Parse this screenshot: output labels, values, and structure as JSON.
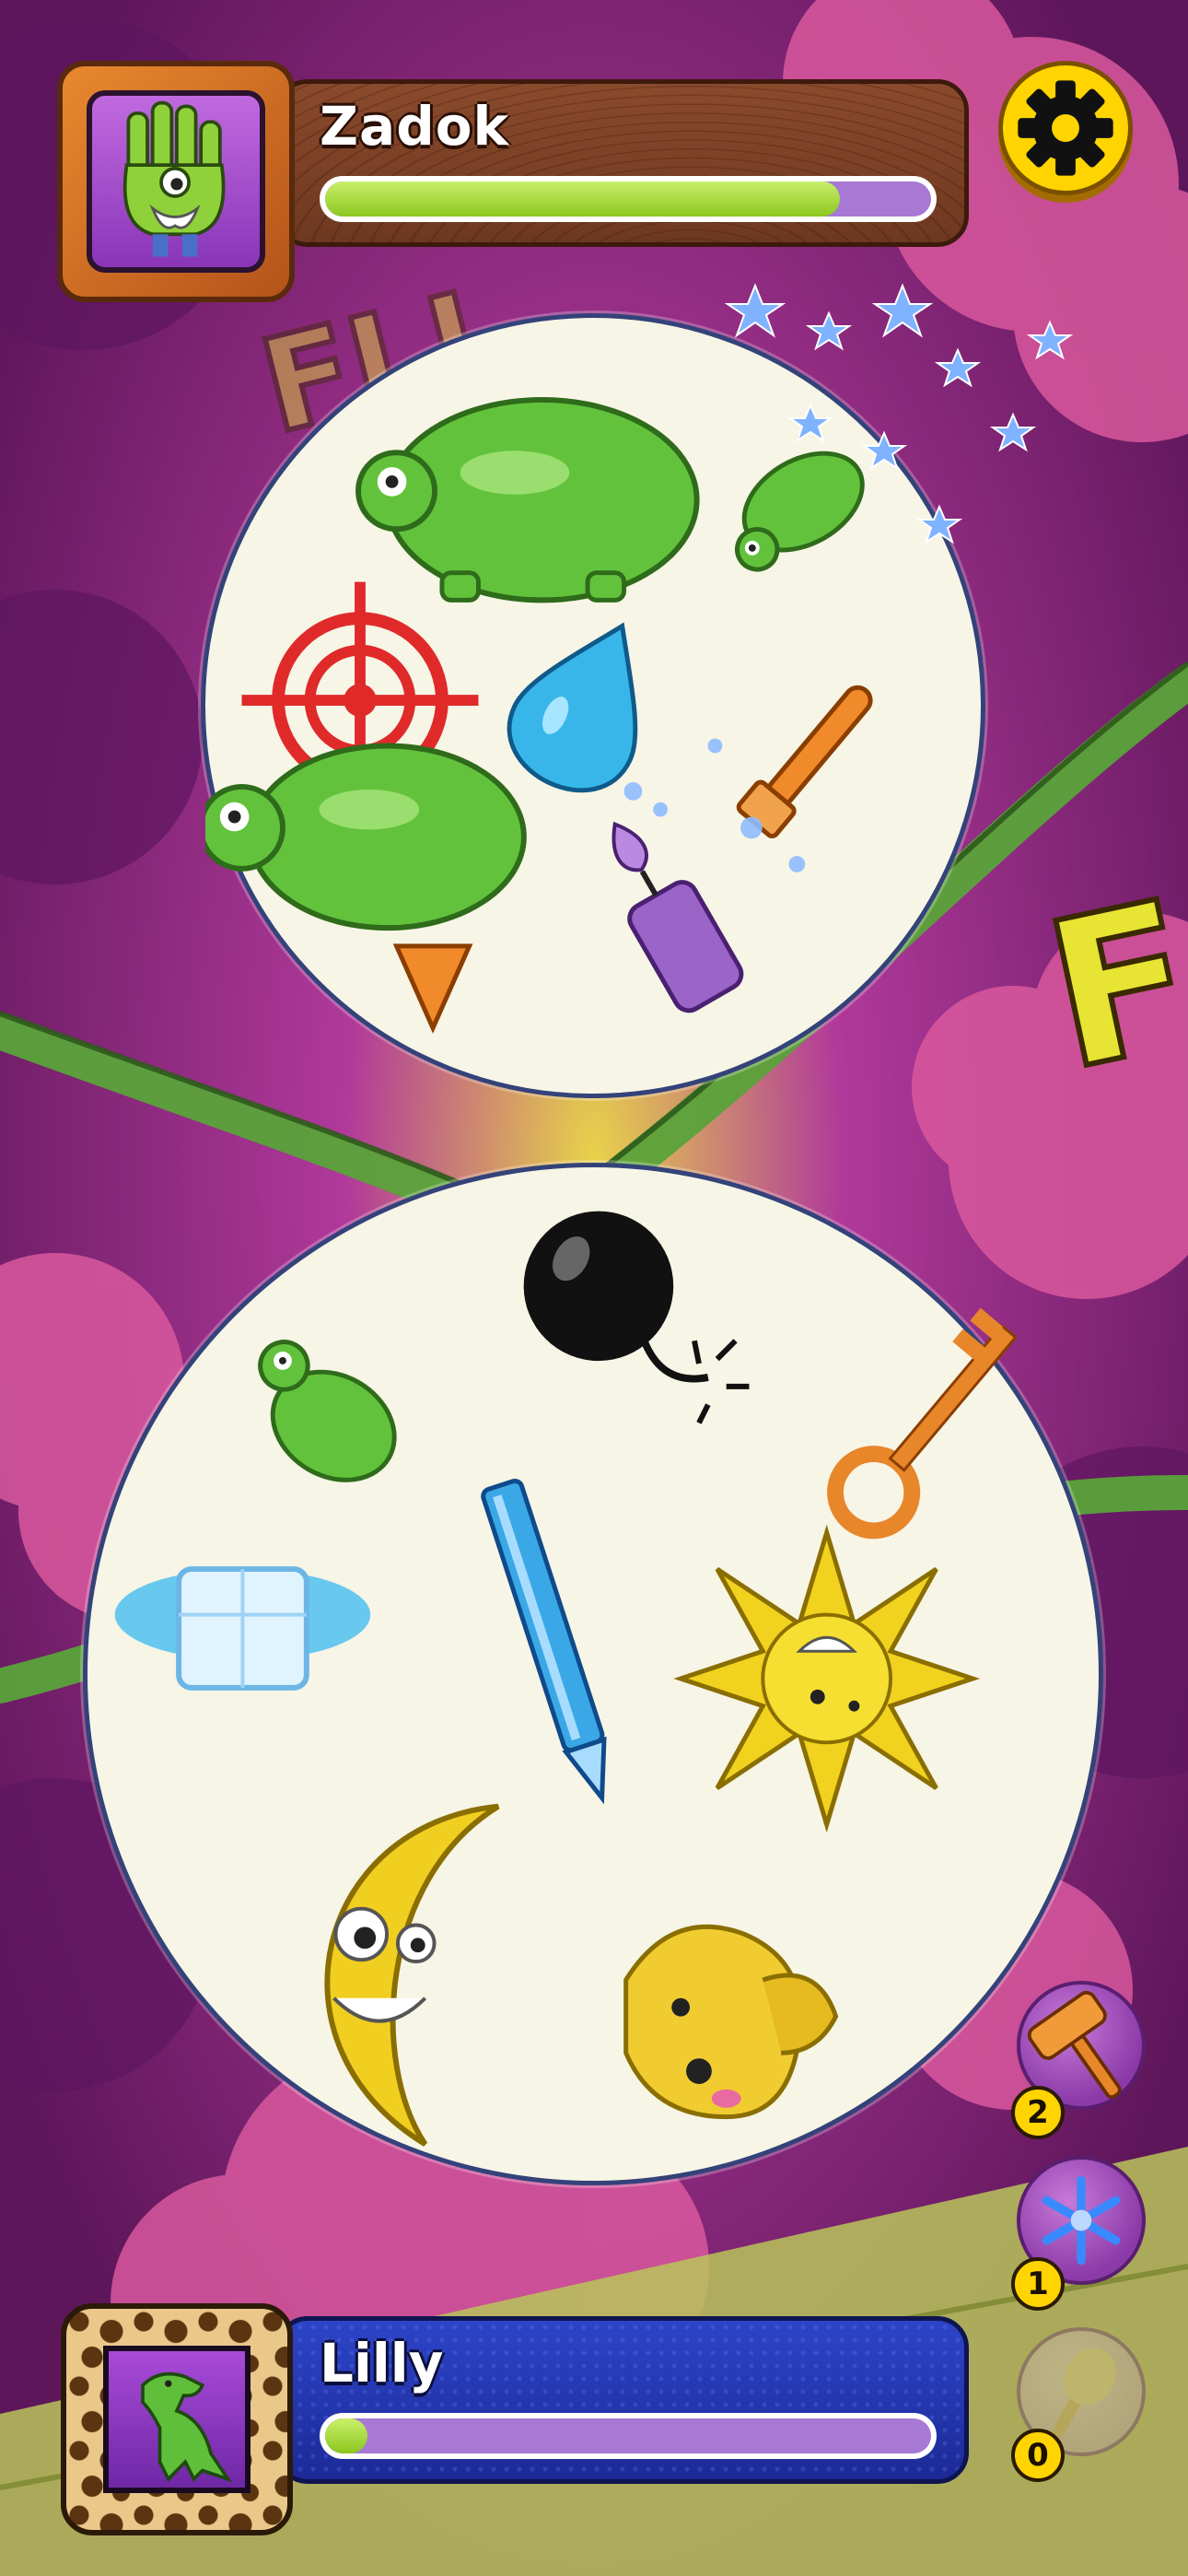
{
  "opponent": {
    "name": "Zadok",
    "progress": 0.85
  },
  "player": {
    "name": "Lilly",
    "progress": 0.05
  },
  "settings": {
    "icon": "gear-icon"
  },
  "top_card": {
    "symbols": [
      "turtle",
      "turtle",
      "turtle",
      "target",
      "water-drop",
      "paintbrush",
      "candle",
      "carrot"
    ]
  },
  "bottom_card": {
    "symbols": [
      "bomb",
      "turtle",
      "key",
      "ice-cube",
      "pencil",
      "sun",
      "moon",
      "dog"
    ]
  },
  "powerups": [
    {
      "name": "hammer",
      "count": "2"
    },
    {
      "name": "snowflake",
      "count": "1"
    },
    {
      "name": "magic-wand",
      "count": "0"
    }
  ],
  "colors": {
    "background": "#7a1f6a",
    "opponent_bar": "#6e3820",
    "player_bar": "#1c2a96",
    "progress_fill": "#8bc71e",
    "progress_track": "#a778d4",
    "settings_button": "#ffd400",
    "card": "#f7f5e6"
  }
}
